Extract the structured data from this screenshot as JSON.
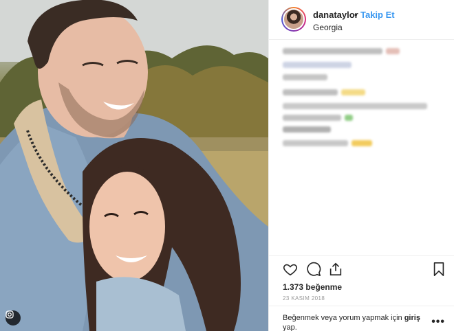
{
  "post": {
    "username": "danataylor",
    "separator": "•",
    "follow_label": "Takip Et",
    "location": "Georgia",
    "likes": "1.373 beğenme",
    "date": "23 KASIM 2018",
    "prompt_text": "Beğenmek veya yorum yapmak için",
    "login_label": "giriş",
    "prompt_suffix": "yap.",
    "more_icon": "more-options-icon"
  },
  "icons": {
    "like": "heart-icon",
    "comment": "comment-icon",
    "share": "share-icon",
    "save": "bookmark-icon",
    "photo_badge": "instagram-icon"
  },
  "colors": {
    "link_blue": "#3897f0",
    "text": "#262626",
    "muted": "#999999",
    "divider": "#efefef"
  }
}
